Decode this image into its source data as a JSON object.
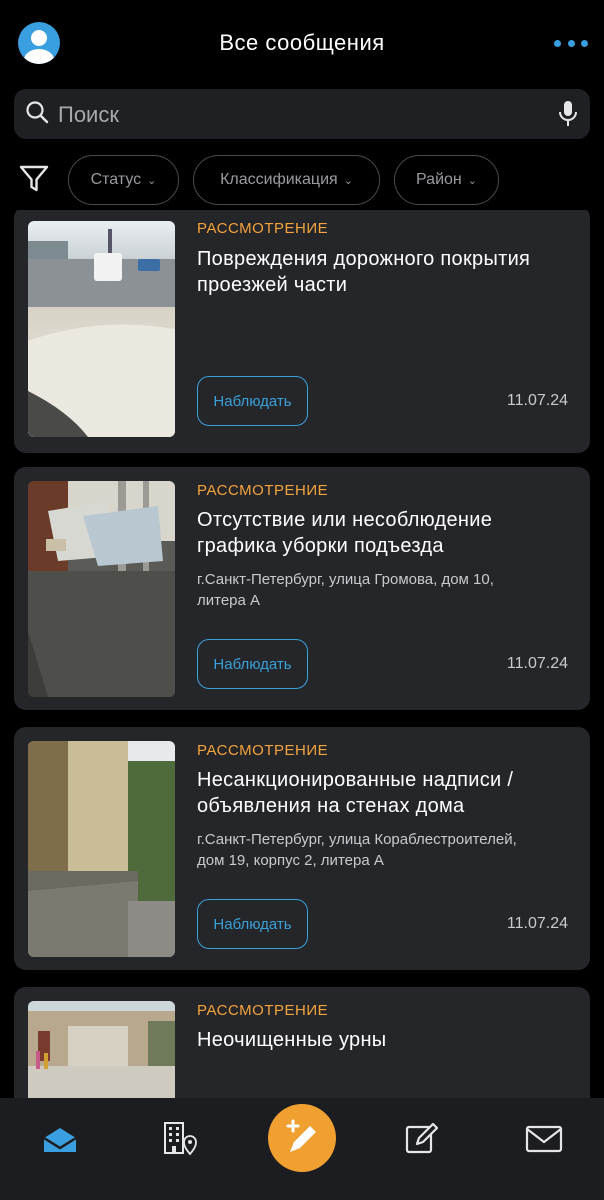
{
  "header": {
    "title": "Все сообщения",
    "accent_color": "#3a9fe0"
  },
  "search": {
    "placeholder": "Поиск"
  },
  "filters": {
    "status": "Статус",
    "classification": "Классификация",
    "district": "Район"
  },
  "cards": [
    {
      "status": "РАССМОТРЕНИЕ",
      "title_line1": "Повреждения дорожного покрытия",
      "title_line2": "проезжей части",
      "address_line1": "",
      "address_line2": "",
      "watch_label": "Наблюдать",
      "date": "11.07.24"
    },
    {
      "status": "РАССМОТРЕНИЕ",
      "title_line1": "Отсутствие или несоблюдение",
      "title_line2": "графика уборки подъезда",
      "address_line1": "г.Санкт-Петербург, улица Громова, дом 10,",
      "address_line2": "литера А",
      "watch_label": "Наблюдать",
      "date": "11.07.24"
    },
    {
      "status": "РАССМОТРЕНИЕ",
      "title_line1": "Несанкционированные надписи /",
      "title_line2": "объявления на стенах дома",
      "address_line1": "г.Санкт-Петербург, улица Кораблестроителей,",
      "address_line2": "дом 19, корпус 2, литера А",
      "watch_label": "Наблюдать",
      "date": "11.07.24"
    },
    {
      "status": "РАССМОТРЕНИЕ",
      "title_line1": "Неочищенные урны",
      "title_line2": ""
    }
  ],
  "tabbar": {
    "items": [
      "home-icon",
      "building-location-icon",
      "new-report-icon",
      "edit-icon",
      "mail-icon"
    ],
    "fab_color": "#f0a030",
    "active_color": "#3a9fe0"
  }
}
